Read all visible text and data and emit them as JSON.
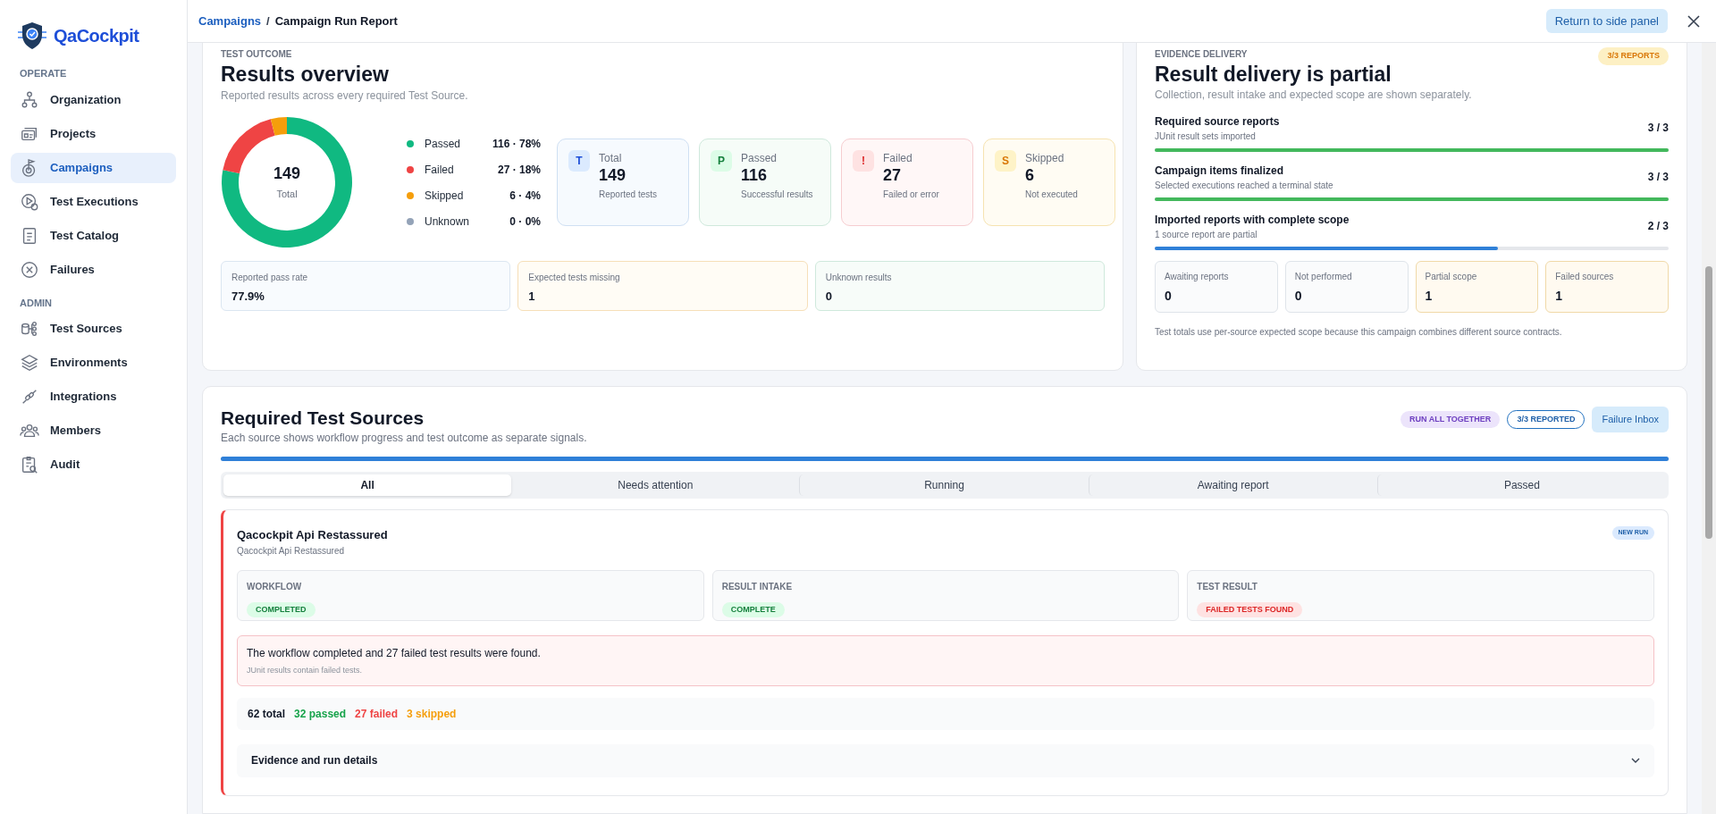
{
  "sidebar": {
    "logo": "QaCockpit",
    "sections": [
      {
        "heading": "OPERATE",
        "items": [
          {
            "label": "Organization",
            "selected": false
          },
          {
            "label": "Projects",
            "selected": false
          },
          {
            "label": "Campaigns",
            "selected": true
          },
          {
            "label": "Test Executions",
            "selected": false
          },
          {
            "label": "Test Catalog",
            "selected": false
          },
          {
            "label": "Failures",
            "selected": false
          }
        ]
      },
      {
        "heading": "ADMIN",
        "items": [
          {
            "label": "Test Sources",
            "selected": false
          },
          {
            "label": "Environments",
            "selected": false
          },
          {
            "label": "Integrations",
            "selected": false
          },
          {
            "label": "Members",
            "selected": false
          },
          {
            "label": "Audit",
            "selected": false
          }
        ]
      }
    ]
  },
  "header": {
    "breadcrumb": [
      {
        "label": "Campaigns",
        "kind": "link"
      },
      {
        "label": "Campaign Run Report",
        "kind": "current"
      }
    ],
    "separator": "/",
    "return_button": "Return to side panel"
  },
  "results_overview": {
    "eyebrow": "TEST OUTCOME",
    "title": "Results overview",
    "subtitle": "Reported results across every required Test Source.",
    "donut": {
      "center_value": "149",
      "center_label": "Total",
      "chart_data": {
        "type": "donut",
        "categories": [
          "Passed",
          "Failed",
          "Skipped",
          "Unknown"
        ],
        "values": [
          78,
          18,
          4,
          0
        ],
        "colors": [
          "#10b981",
          "#ef4444",
          "#f59e0b",
          "#94a3b8"
        ]
      }
    },
    "legend": [
      {
        "value": "116 · 78%"
      },
      {
        "value": "27 · 18%"
      },
      {
        "value": "6 · 4%"
      },
      {
        "value": "0 · 0%"
      }
    ],
    "stats": [
      {
        "kind": "total",
        "badge": "T",
        "label": "Total",
        "value": "149",
        "caption": "Reported tests"
      },
      {
        "kind": "passed",
        "badge": "P",
        "label": "Passed",
        "value": "116",
        "caption": "Successful results"
      },
      {
        "kind": "failed",
        "badge": "!",
        "label": "Failed",
        "value": "27",
        "caption": "Failed or error"
      },
      {
        "kind": "skipped",
        "badge": "S",
        "label": "Skipped",
        "value": "6",
        "caption": "Not executed"
      }
    ],
    "metrics": [
      {
        "kind": "info",
        "label": "Reported pass rate",
        "value": "77.9%"
      },
      {
        "kind": "warning",
        "label": "Expected tests missing",
        "value": "1"
      },
      {
        "kind": "success",
        "label": "Unknown results",
        "value": "0"
      }
    ]
  },
  "evidence_delivery": {
    "eyebrow": "EVIDENCE DELIVERY",
    "badge": "3/3 REPORTS",
    "title": "Result delivery is partial",
    "subtitle": "Collection, result intake and expected scope are shown separately.",
    "progress": [
      {
        "label": "Required source reports",
        "caption": "JUnit result sets imported",
        "reading": "3 / 3",
        "level": 1
      },
      {
        "label": "Campaign items finalized",
        "caption": "Selected executions reached a terminal state",
        "reading": "3 / 3",
        "level": 1
      },
      {
        "label": "Imported reports with complete scope",
        "caption": "1 source report are partial",
        "reading": "2 / 3",
        "level": 0.667
      }
    ],
    "counters": [
      {
        "kind": "neutral",
        "label": "Awaiting reports",
        "value": "0"
      },
      {
        "kind": "neutral",
        "label": "Not performed",
        "value": "0"
      },
      {
        "kind": "warning",
        "label": "Partial scope",
        "value": "1"
      },
      {
        "kind": "warning",
        "label": "Failed sources",
        "value": "1"
      }
    ],
    "note": "Test totals use per-source expected scope because this campaign combines different source contracts."
  },
  "required_sources": {
    "title": "Required Test Sources",
    "subtitle": "Each source shows workflow progress and test outcome as separate signals.",
    "badges": [
      {
        "kind": "mode",
        "label": "RUN ALL TOGETHER"
      },
      {
        "kind": "outline",
        "label": "3/3 REPORTED"
      }
    ],
    "button": "Failure Inbox",
    "level": 1,
    "tabs": [
      {
        "label": "All",
        "selected": true
      },
      {
        "label": "Needs attention",
        "selected": false
      },
      {
        "label": "Running",
        "selected": false
      },
      {
        "label": "Awaiting report",
        "selected": false
      },
      {
        "label": "Passed",
        "selected": false
      }
    ],
    "source": {
      "title": "Qacockpit Api Restassured",
      "subtitle": "Qacockpit Api Restassured",
      "badge": "NEW RUN",
      "statuses": [
        {
          "label": "WORKFLOW",
          "value": "COMPLETED",
          "kind": "success"
        },
        {
          "label": "RESULT INTAKE",
          "value": "COMPLETE",
          "kind": "success"
        },
        {
          "label": "TEST RESULT",
          "value": "FAILED TESTS FOUND",
          "kind": "danger"
        }
      ],
      "alert": {
        "message": "The workflow completed and 27 failed test results were found.",
        "detail": "JUnit results contain failed tests."
      },
      "counts": [
        {
          "kind": "total",
          "label": "62 total"
        },
        {
          "kind": "passed",
          "label": "32 passed"
        },
        {
          "kind": "failed",
          "label": "27 failed"
        },
        {
          "kind": "skipped",
          "label": "3 skipped"
        }
      ],
      "details": {
        "label": "Evidence and run details",
        "expanded": false
      }
    }
  }
}
